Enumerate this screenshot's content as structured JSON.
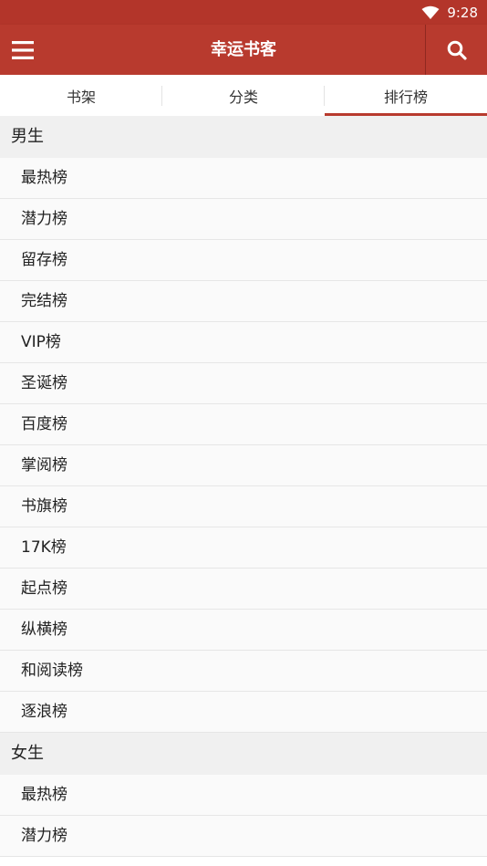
{
  "status_bar": {
    "time": "9:28",
    "icons": [
      "wifi-icon"
    ]
  },
  "app_bar": {
    "title": "幸运书客",
    "menu_icon": "menu-icon",
    "search_icon": "search-icon"
  },
  "colors": {
    "primary": "#b83a2e",
    "status_bar": "#b3352a",
    "section_bg": "#f0f0f0",
    "item_bg": "#fafafa"
  },
  "tabs": [
    {
      "label": "书架",
      "active": false
    },
    {
      "label": "分类",
      "active": false
    },
    {
      "label": "排行榜",
      "active": true
    }
  ],
  "sections": [
    {
      "title": "男生",
      "items": [
        "最热榜",
        "潜力榜",
        "留存榜",
        "完结榜",
        "VIP榜",
        "圣诞榜",
        "百度榜",
        "掌阅榜",
        "书旗榜",
        "17K榜",
        "起点榜",
        "纵横榜",
        "和阅读榜",
        "逐浪榜"
      ]
    },
    {
      "title": "女生",
      "items": [
        "最热榜",
        "潜力榜"
      ]
    }
  ]
}
